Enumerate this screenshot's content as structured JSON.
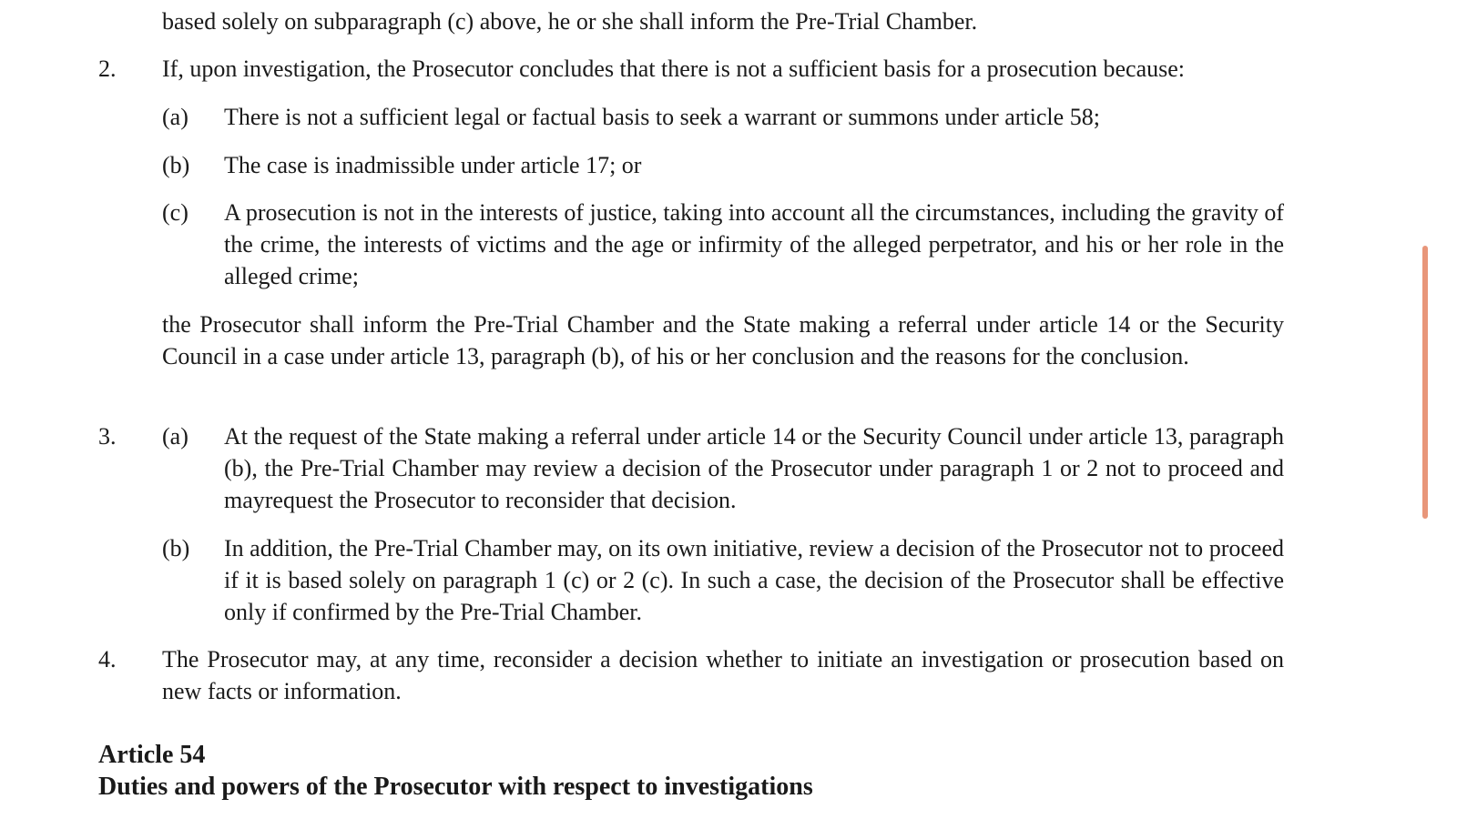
{
  "document": {
    "top_continuation": "based solely on subparagraph (c) above, he or she shall inform the Pre-Trial Chamber.",
    "para2": {
      "number": "2.",
      "intro": "If, upon investigation, the Prosecutor concludes that there is not a sufficient basis for a prosecution because:",
      "items": [
        {
          "label": "(a)",
          "text": "There is not a sufficient legal or factual basis to seek a warrant or summons under article 58;"
        },
        {
          "label": "(b)",
          "text": "The case is inadmissible under article 17; or"
        },
        {
          "label": "(c)",
          "text": "A prosecution is not in the interests of justice, taking into account all the circumstances, including the gravity of the crime, the interests of victims and the age or infirmity of the alleged perpetrator, and his or her role in the alleged crime;"
        }
      ],
      "conclusion": "the Prosecutor shall inform the Pre-Trial Chamber and the State making a referral under article 14 or the Security Council in a case under article 13, paragraph (b), of his or her conclusion and the reasons for the conclusion."
    },
    "para3": {
      "number": "3.",
      "items": [
        {
          "label": "(a)",
          "text": "At the request of the State making a referral under article 14 or the Security Council under article 13, paragraph (b), the Pre-Trial Chamber may review a decision of the Prosecutor under paragraph 1 or 2  not to proceed and mayrequest the Prosecutor to reconsider that decision."
        },
        {
          "label": "(b)",
          "text": "In addition, the Pre-Trial Chamber may, on its own initiative, review a decision of the Prosecutor not to proceed if it is based solely on paragraph 1 (c) or 2 (c). In such a case, the decision of the Prosecutor shall be effective only if confirmed by the Pre-Trial Chamber."
        }
      ]
    },
    "para4": {
      "number": "4.",
      "text": "The Prosecutor may, at any time, reconsider a decision whether to initiate an investigation or prosecution based on new facts or information."
    },
    "article": {
      "number_line": "Article 54",
      "title": "Duties and powers of the Prosecutor with respect to investigations"
    }
  },
  "colors": {
    "text": "#1a1a1a",
    "background": "#ffffff",
    "scroll_indicator": "#e8967a"
  }
}
